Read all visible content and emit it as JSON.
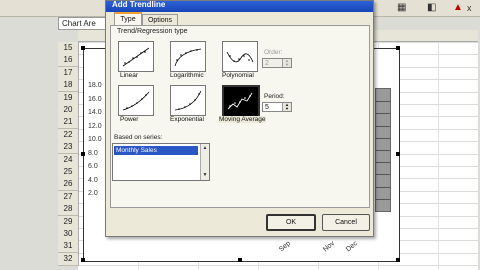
{
  "app": {
    "name_box": "Chart Are",
    "top_right_close": "x"
  },
  "rows": [
    "15",
    "16",
    "17",
    "18",
    "19",
    "20",
    "21",
    "22",
    "23",
    "24",
    "25",
    "26",
    "27",
    "28",
    "29",
    "30",
    "31",
    "32"
  ],
  "chart": {
    "y_ticks": [
      "18.0",
      "16.0",
      "14.0",
      "12.0",
      "10.0",
      "8.0",
      "6.0",
      "4.0",
      "2.0"
    ],
    "x_ticks": [
      "Sep",
      "Nov",
      "Dec"
    ]
  },
  "dialog": {
    "title": "Add Trendline",
    "tabs": [
      {
        "label": "Type"
      },
      {
        "label": "Options"
      }
    ],
    "group_label": "Trend/Regression type",
    "types": [
      {
        "label": "Linear"
      },
      {
        "label": "Logarithmic"
      },
      {
        "label": "Polynomial"
      },
      {
        "label": "Power"
      },
      {
        "label": "Exponential"
      },
      {
        "label": "Moving Average"
      }
    ],
    "order_label": "Order:",
    "order_value": "2",
    "period_label": "Period:",
    "period_value": "5",
    "series_label": "Based on series:",
    "series": [
      "Monthly Sales"
    ],
    "ok": "OK",
    "cancel": "Cancel"
  }
}
